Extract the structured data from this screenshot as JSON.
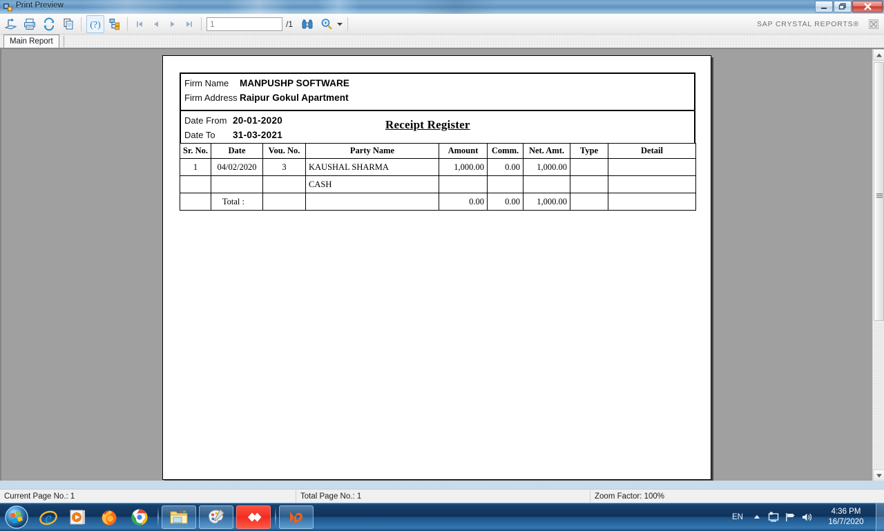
{
  "window": {
    "title": "Print Preview",
    "icon": "application-icon",
    "buttons": {
      "minimize": "minimize-icon",
      "restore": "restore-icon",
      "close": "close-icon"
    }
  },
  "toolbar": {
    "export_icon": "export-icon",
    "print_icon": "print-icon",
    "refresh_icon": "refresh-icon",
    "copy_icon": "copy-icon",
    "help_icon": "help-icon",
    "group_tree_icon": "group-tree-icon",
    "first_page_icon": "first-page-icon",
    "prev_page_icon": "previous-page-icon",
    "next_page_icon": "next-page-icon",
    "last_page_icon": "last-page-icon",
    "page_value": "1",
    "page_total": "/1",
    "search_icon": "binoculars-search-icon",
    "zoom_icon": "zoom-icon",
    "zoom_dropdown_icon": "chevron-down-icon",
    "brand": "SAP CRYSTAL REPORTS®",
    "overflow_icon": "overflow-icon"
  },
  "tabs": {
    "main_report": "Main Report"
  },
  "report": {
    "firm_name_label": "Firm Name",
    "firm_name_value": "MANPUSHP SOFTWARE",
    "firm_address_label": "Firm Address",
    "firm_address_value": "Raipur Gokul Apartment",
    "date_from_label": "Date From",
    "date_from_value": "20-01-2020",
    "date_to_label": "Date To",
    "date_to_value": "31-03-2021",
    "title": "Receipt Register",
    "columns": [
      "Sr. No.",
      "Date",
      "Vou. No.",
      "Party Name",
      "Amount",
      "Comm.",
      "Net. Amt.",
      "Type",
      "Detail"
    ],
    "rows": [
      {
        "sr_no": "1",
        "date": "04/02/2020",
        "vou_no": "3",
        "party_name": "KAUSHAL SHARMA",
        "amount": "1,000.00",
        "comm": "0.00",
        "net_amt": "1,000.00",
        "type": "",
        "detail": ""
      },
      {
        "sr_no": "",
        "date": "",
        "vou_no": "",
        "party_name": "CASH",
        "amount": "",
        "comm": "",
        "net_amt": "",
        "type": "",
        "detail": ""
      },
      {
        "sr_no": "",
        "date": "Total :",
        "vou_no": "",
        "party_name": "",
        "amount": "0.00",
        "comm": "0.00",
        "net_amt": "1,000.00",
        "type": "",
        "detail": ""
      }
    ]
  },
  "status_bar": {
    "current_page": "Current Page No.: 1",
    "total_page": "Total Page No.: 1",
    "zoom_factor": "Zoom Factor: 100%"
  },
  "taskbar": {
    "start_icon": "windows-start-icon",
    "items": [
      {
        "name": "internet-explorer-icon",
        "running": false
      },
      {
        "name": "windows-media-player-icon",
        "running": false
      },
      {
        "name": "firefox-icon",
        "running": false
      },
      {
        "name": "google-chrome-icon",
        "running": false
      },
      {
        "name": "file-explorer-icon",
        "running": true
      },
      {
        "name": "paint-icon",
        "running": true
      },
      {
        "name": "red-app-icon",
        "running": true
      },
      {
        "name": "orange-m-app-icon",
        "running": true
      }
    ],
    "tray": {
      "language": "EN",
      "show_hidden_icons": "chevron-up-icon",
      "action_center_icon": "action-center-icon",
      "network_icon": "network-icon",
      "volume_icon": "volume-icon",
      "time": "4:36 PM",
      "date": "16/7/2020"
    }
  },
  "colors": {
    "accent": "#1d4f7c",
    "taskbar": "#123256",
    "close_button": "#c8392d",
    "page_background": "#a0a0a0"
  }
}
